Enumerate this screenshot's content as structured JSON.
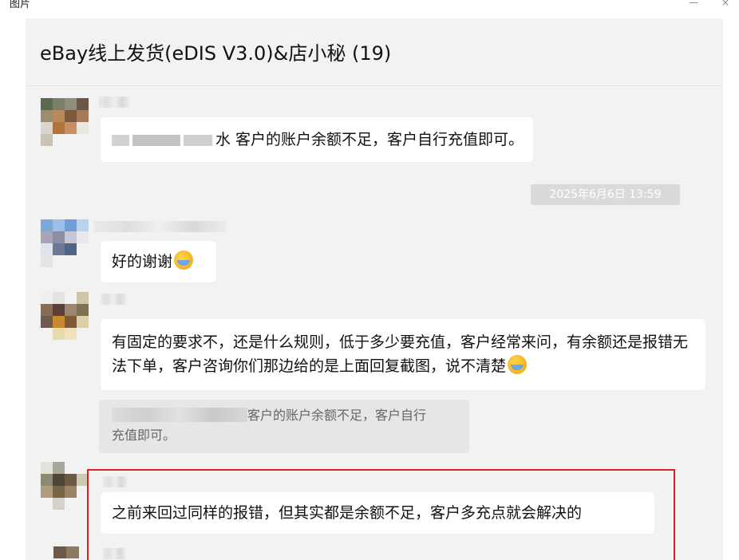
{
  "app": {
    "label": "图片",
    "minimize_glyph": "—",
    "close_glyph": "×"
  },
  "chat": {
    "title": "eBay线上发货(eDIS V3.0)&店小秘 (19)"
  },
  "messages": [
    {
      "id": "m1",
      "text_visible": "水 客户的账户余额不足，客户自行充值即可。"
    },
    {
      "id": "m2",
      "text": "好的谢谢"
    },
    {
      "id": "m3",
      "text": "有固定的要求不，还是什么规则，低于多少要充值，客户经常来问，有余额还是报错无法下单，客户咨询你们那边给的是上面回复截图，说不清楚"
    },
    {
      "id": "m4",
      "text": "之前来回过同样的报错，但其实都是余额不足，客户多充点就会解决的"
    }
  ],
  "timestamp": "2025年6月6日 13:59",
  "quote": {
    "text_line1": "客户的账户余额不足，客户自行",
    "text_line2": "充值即可。"
  },
  "colors": {
    "chat_bg": "#f2f2f2",
    "bubble_bg": "#ffffff",
    "timestamp_bg": "#dadada",
    "highlight": "#e0201f"
  },
  "icons": {
    "emoji": "face-with-tears-of-joy-icon"
  }
}
